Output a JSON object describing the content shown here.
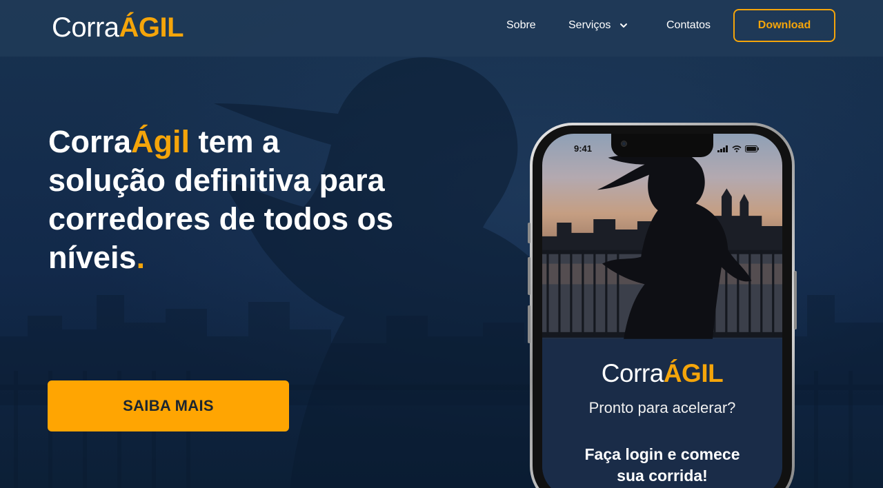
{
  "header": {
    "logo": {
      "part1": "Corra",
      "part2": "ÁGIL"
    },
    "nav": {
      "sobre": "Sobre",
      "servicos": "Serviços",
      "contatos": "Contatos"
    },
    "download_label": "Download"
  },
  "hero": {
    "brand_white": "Corra",
    "brand_accent": "Ágil",
    "line1_rest": " tem a",
    "line2": "solução definitiva para",
    "line3": "corredores de todos os",
    "line4": "níveis",
    "period": ".",
    "cta_label": "SAIBA MAIS"
  },
  "phone": {
    "time": "9:41",
    "logo": {
      "part1": "Corra",
      "part2": "ÁGIL"
    },
    "subtitle": "Pronto para acelerar?",
    "cta_line1": "Faça login e comece",
    "cta_line2": "sua corrida!"
  },
  "colors": {
    "accent": "#f5a50a",
    "cta": "#ffa502",
    "background": "#0f2540",
    "header": "#203a58"
  },
  "icons": [
    "chevron-down-icon",
    "camera-icon",
    "signal-icon",
    "wifi-icon",
    "battery-icon"
  ]
}
